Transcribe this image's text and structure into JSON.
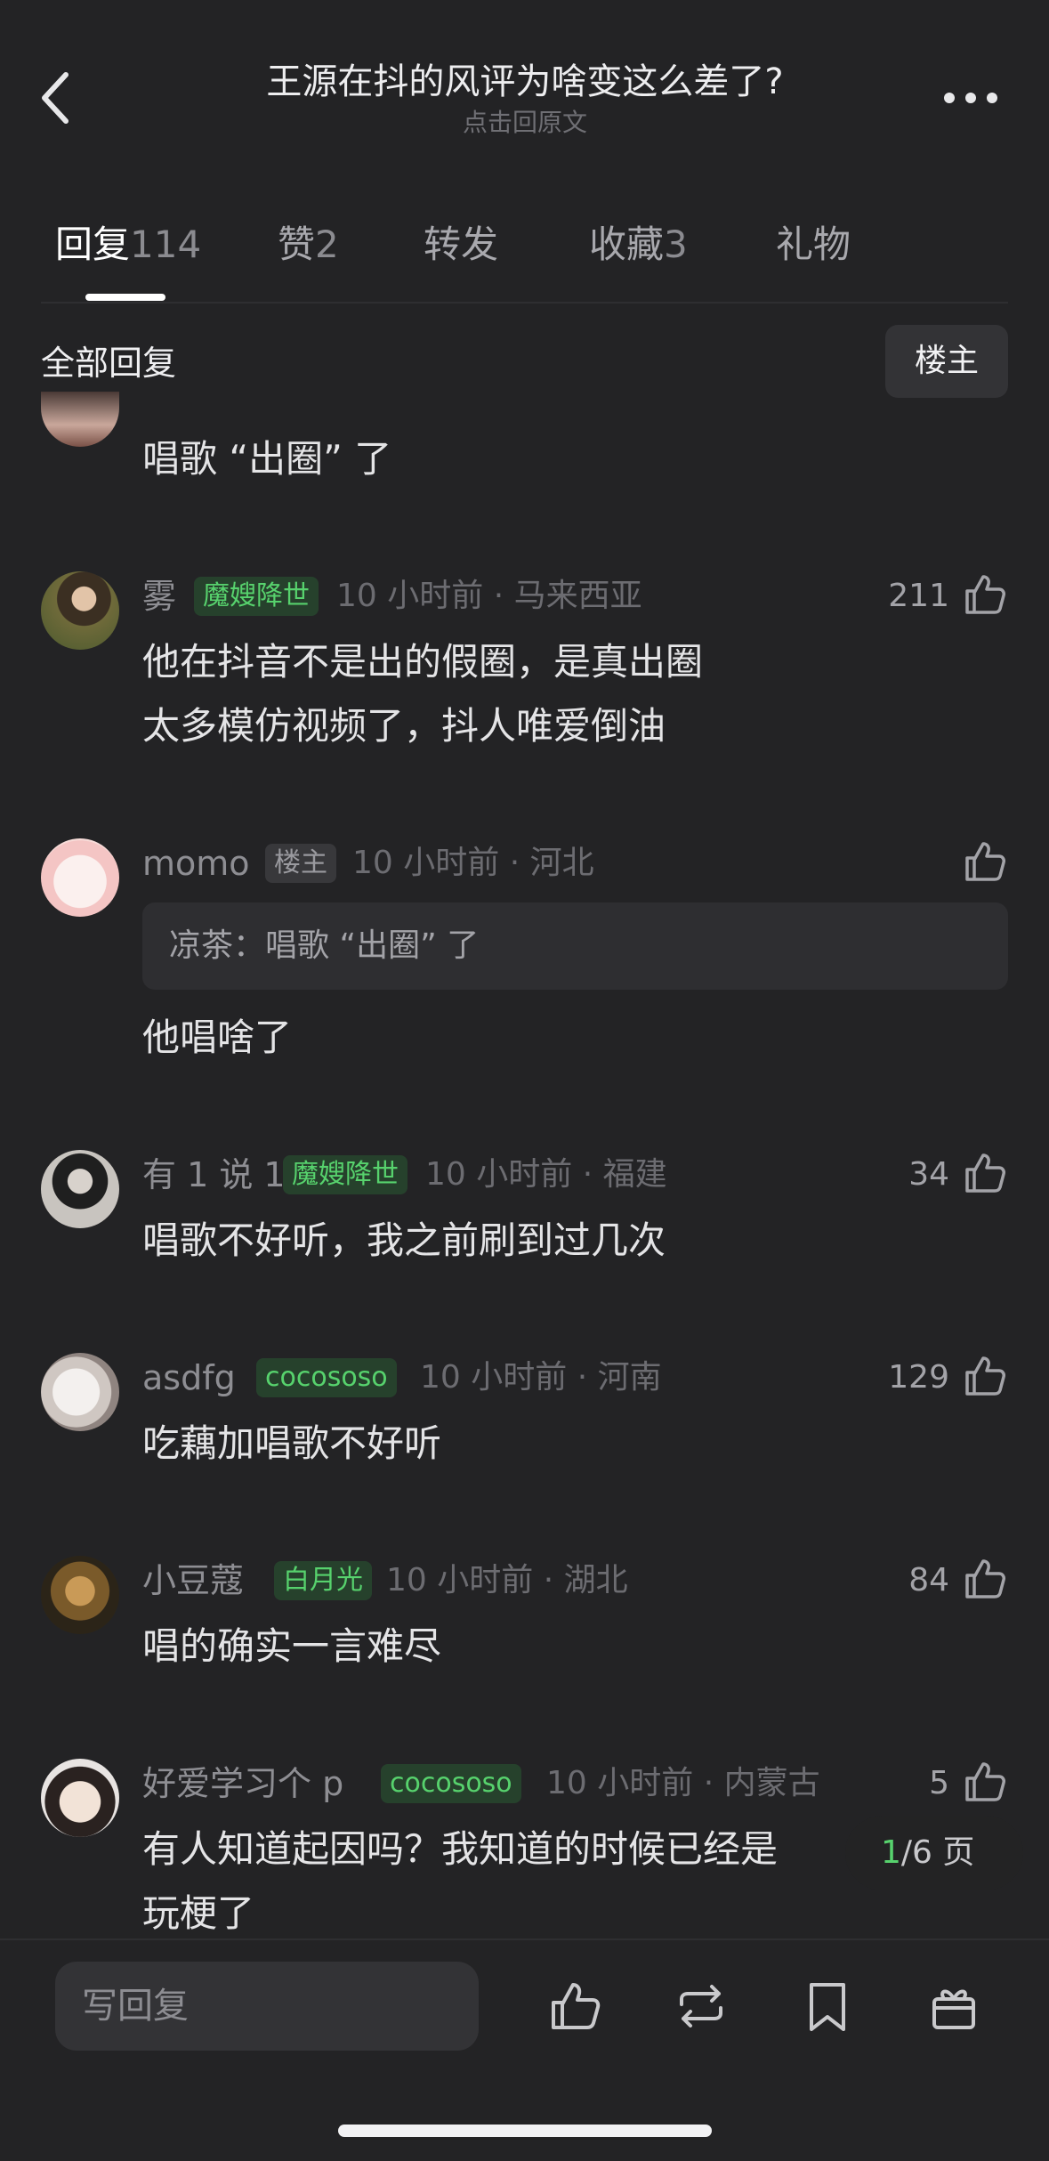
{
  "header": {
    "title": "王源在抖的风评为啥变这么差了?",
    "subtitle": "点击回原文"
  },
  "tabs": [
    {
      "label": "回复",
      "count": "114"
    },
    {
      "label": "赞",
      "count": "2"
    },
    {
      "label": "转发",
      "count": ""
    },
    {
      "label": "收藏",
      "count": "3"
    },
    {
      "label": "礼物",
      "count": ""
    }
  ],
  "filter": {
    "label": "全部回复",
    "owner_button": "楼主"
  },
  "comments": [
    {
      "text_lines": [
        "唱歌 “出圈” 了"
      ]
    },
    {
      "username": "雾",
      "badge": "魔嫂降世",
      "meta": "10 小时前 · 马来西亚",
      "likes": "211",
      "text_lines": [
        "他在抖音不是出的假圈，是真出圈",
        "太多模仿视频了，抖人唯爱倒油"
      ]
    },
    {
      "username": "momo",
      "badge": "楼主",
      "meta": "10 小时前 · 河北",
      "likes": "",
      "quote": "凉茶：唱歌 “出圈” 了",
      "text_lines": [
        "他唱啥了"
      ]
    },
    {
      "username": "有 1 说 1",
      "badge": "魔嫂降世",
      "meta": "10 小时前 · 福建",
      "likes": "34",
      "text_lines": [
        "唱歌不好听，我之前刷到过几次"
      ]
    },
    {
      "username": "asdfg",
      "badge": "cocososo",
      "meta": "10 小时前 · 河南",
      "likes": "129",
      "text_lines": [
        "吃藕加唱歌不好听"
      ]
    },
    {
      "username": "小豆蔻",
      "badge": "白月光",
      "meta": "10 小时前 · 湖北",
      "likes": "84",
      "text_lines": [
        "唱的确实一言难尽"
      ]
    },
    {
      "username": "好爱学习个 p",
      "badge": "cocososo",
      "meta": "10 小时前 · 内蒙古",
      "likes": "5",
      "text_lines": [
        "有人知道起因吗？我知道的时候已经是",
        "玩梗了"
      ]
    }
  ],
  "page_indicator": {
    "current": "1",
    "total": "/6 页"
  },
  "bottom_bar": {
    "reply_placeholder": "写回复",
    "icons": [
      "like-icon",
      "repost-icon",
      "bookmark-icon",
      "gift-icon"
    ]
  },
  "colors": {
    "background": "#232325",
    "badge_green_text": "#57d26d",
    "badge_green_bg": "#26412c"
  }
}
